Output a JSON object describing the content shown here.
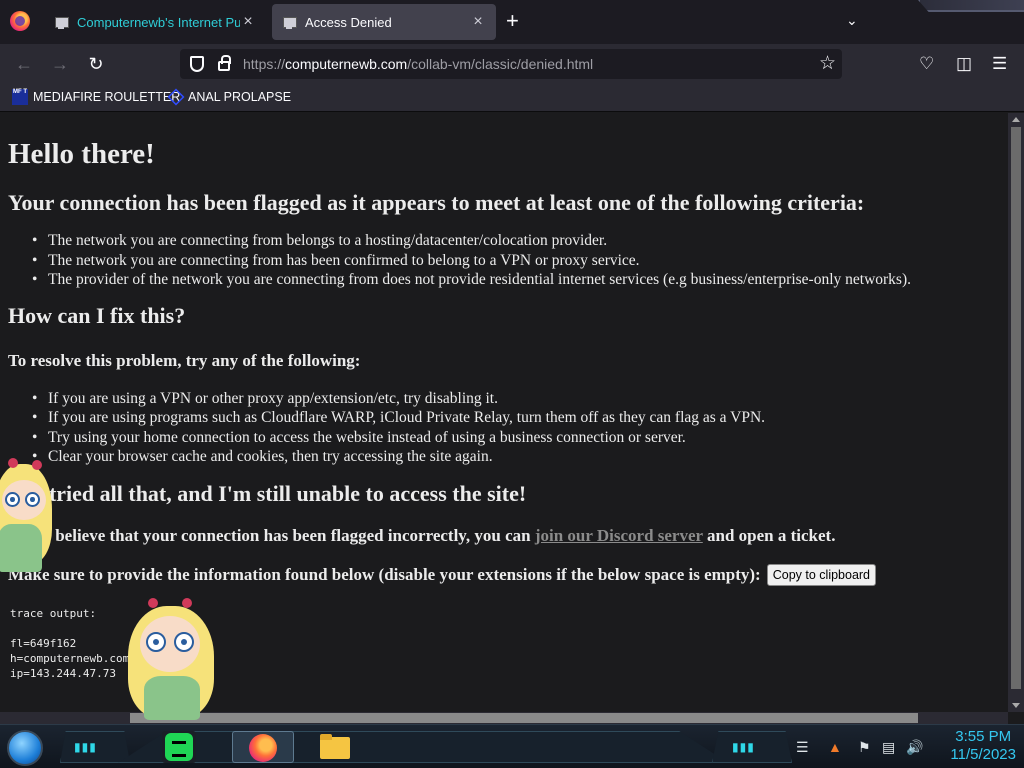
{
  "browser": {
    "tabs": [
      {
        "title": "Computernewb's Internet Pub",
        "active": false
      },
      {
        "title": "Access Denied",
        "active": true
      }
    ],
    "new_tab_symbol": "+",
    "close_symbol": "×",
    "url_prefix": "https://",
    "url_host": "computernewb.com",
    "url_path": "/collab-vm/classic/denied.html",
    "bookmarks": [
      {
        "label": "MEDIAFIRE ROULETTER",
        "icon": "mediafire-icon",
        "icon_text": "MF T"
      },
      {
        "label": "ANAL PROLAPSE",
        "icon": "bookmark-diamond-icon"
      }
    ]
  },
  "page": {
    "heading": "Hello there!",
    "flagged_heading": "Your connection has been flagged as it appears to meet at least one of the following criteria:",
    "criteria": [
      "The network you are connecting from belongs to a hosting/datacenter/colocation provider.",
      "The network you are connecting from has been confirmed to belong to a VPN or proxy service.",
      "The provider of the network you are connecting from does not provide residential internet services (e.g business/enterprise-only networks)."
    ],
    "fix_heading": "How can I fix this?",
    "resolve_heading": "To resolve this problem, try any of the following:",
    "fixes": [
      "If you are using a VPN or other proxy app/extension/etc, try disabling it.",
      "If you are using programs such as Cloudflare WARP, iCloud Private Relay, turn them off as they can flag as a VPN.",
      "Try using your home connection to access the website instead of using a business connection or server.",
      "Clear your browser cache and cookies, then try accessing the site again."
    ],
    "tried_heading": "I've tried all that, and I'm still unable to access the site!",
    "discord_before": "If you believe that your connection has been flagged incorrectly, you can ",
    "discord_link": "join our Discord server",
    "discord_after": " and open a ticket.",
    "provide_text": "Make sure to provide the information found below (disable your extensions if the below space is empty):",
    "copy_button": "Copy to clipboard",
    "trace_lines": [
      "trace output:",
      "",
      "fl=649f162",
      "h=computernewb.com",
      "ip=143.244.47.73"
    ]
  },
  "taskbar": {
    "apps": [
      "notes-app-icon",
      "firefox-icon",
      "file-explorer-icon"
    ],
    "clock_time": "3:55 PM",
    "clock_date": "11/5/2023"
  },
  "colors": {
    "page_bg": "#1b1b1d",
    "inactive_tab_text": "#2fcdd6",
    "link": "#8b8b8b",
    "clock": "#34c8f0"
  }
}
